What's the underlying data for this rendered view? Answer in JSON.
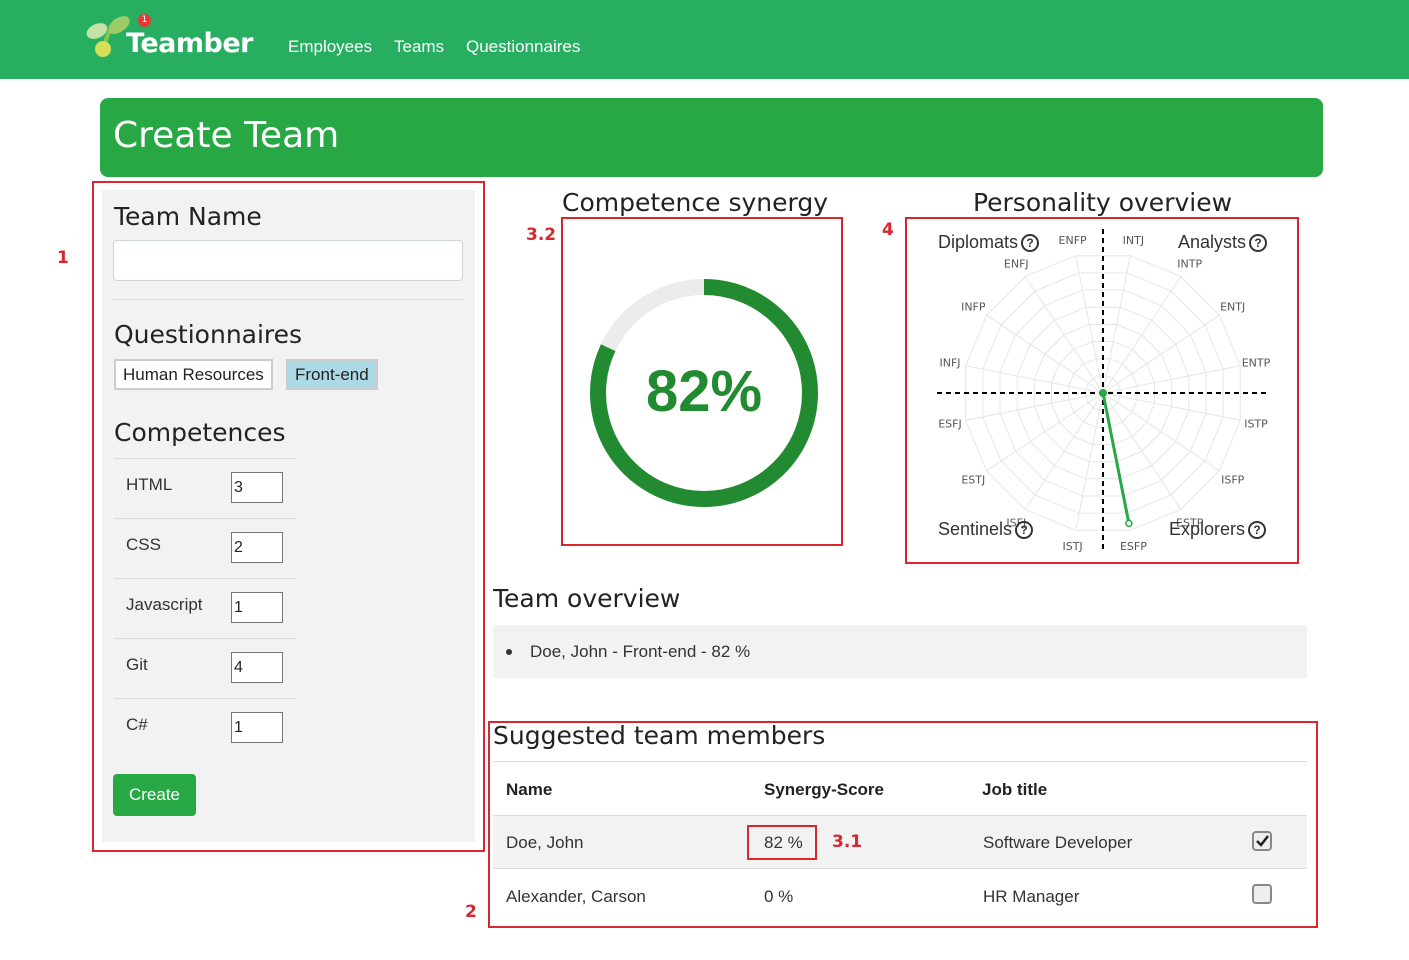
{
  "nav": {
    "brand": "Teamber",
    "badge": "1",
    "links": [
      "Employees",
      "Teams",
      "Questionnaires"
    ]
  },
  "header": {
    "title": "Create Team"
  },
  "form": {
    "team_name_label": "Team Name",
    "team_name_value": "",
    "questionnaires_label": "Questionnaires",
    "questionnaires": [
      {
        "label": "Human Resources",
        "selected": false
      },
      {
        "label": "Front-end",
        "selected": true
      }
    ],
    "competences_label": "Competences",
    "competences": [
      {
        "name": "HTML",
        "value": "3"
      },
      {
        "name": "CSS",
        "value": "2"
      },
      {
        "name": "Javascript",
        "value": "1"
      },
      {
        "name": "Git",
        "value": "4"
      },
      {
        "name": "C#",
        "value": "1"
      }
    ],
    "create_label": "Create"
  },
  "competence_synergy": {
    "title": "Competence synergy",
    "value_text": "82%",
    "value": 0.82,
    "color": "#228b31"
  },
  "personality": {
    "title": "Personality overview",
    "quadrants": [
      "Diplomats",
      "Analysts",
      "Sentinels",
      "Explorers"
    ],
    "types": [
      "INTJ",
      "INTP",
      "ENTJ",
      "ENTP",
      "ISTP",
      "ISFP",
      "ESTP",
      "ESFP",
      "ISTJ",
      "ISFJ",
      "ESTJ",
      "ESFJ",
      "INFJ",
      "INFP",
      "ENFJ",
      "ENFP"
    ],
    "highlight": "ESFP",
    "highlight_color": "#28a745"
  },
  "team_overview": {
    "title": "Team overview",
    "members": [
      "Doe, John - Front-end - 82 %"
    ]
  },
  "suggested": {
    "title": "Suggested team members",
    "columns": [
      "Name",
      "Synergy-Score",
      "Job title"
    ],
    "rows": [
      {
        "name": "Doe, John",
        "score": "82 %",
        "job": "Software Developer",
        "checked": true
      },
      {
        "name": "Alexander, Carson",
        "score": "0 %",
        "job": "HR Manager",
        "checked": false
      }
    ]
  },
  "annotations": [
    "1",
    "2",
    "3.1",
    "3.2",
    "4"
  ]
}
